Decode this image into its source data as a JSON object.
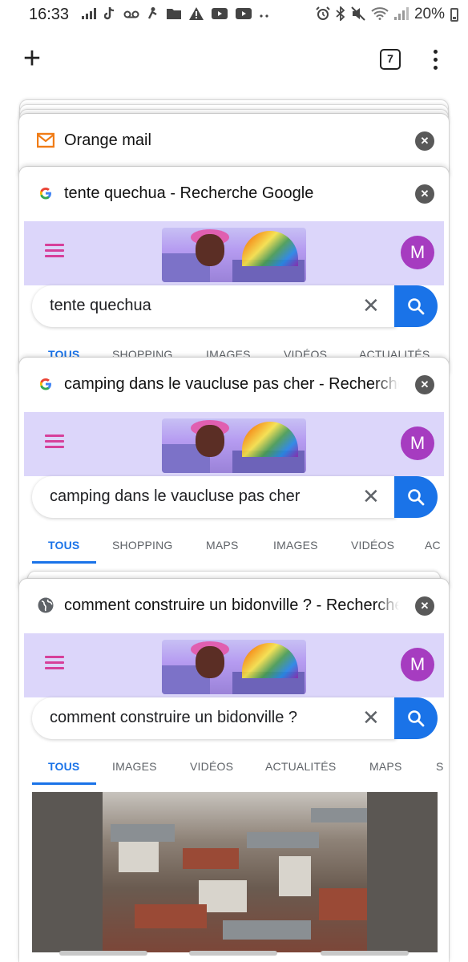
{
  "status_bar": {
    "time": "16:33",
    "battery": "20%",
    "left_icons": [
      "data-usage-icon",
      "tiktok-icon",
      "voicemail-icon",
      "accessibility-icon",
      "folder-icon",
      "warning-icon",
      "youtube-icon",
      "youtube-icon",
      "more-dots-icon"
    ],
    "right_icons": [
      "alarm-icon",
      "bluetooth-icon",
      "mute-icon",
      "wifi-icon",
      "signal-icon",
      "battery-icon"
    ]
  },
  "toolbar": {
    "new_tab_label": "+",
    "tab_count": "7"
  },
  "tabs": [
    {
      "title": "Orange mail",
      "favicon": "orange-mail-icon"
    },
    {
      "title": "tente quechua - Recherche Google",
      "favicon": "google-icon",
      "avatar": "M",
      "search_query": "tente quechua",
      "nav_tabs": [
        "TOUS",
        "SHOPPING",
        "IMAGES",
        "VIDÉOS",
        "ACTUALITÉS"
      ]
    },
    {
      "title": "camping dans le vaucluse pas cher - Recherche Google",
      "favicon": "google-icon",
      "avatar": "M",
      "search_query": "camping dans le vaucluse pas cher",
      "nav_tabs": [
        "TOUS",
        "SHOPPING",
        "MAPS",
        "IMAGES",
        "VIDÉOS",
        "AC"
      ]
    },
    {
      "title": "comment construire un bidonville ? - Recherche Google",
      "favicon": "globe-icon",
      "avatar": "M",
      "search_query": "comment construire un bidonville ?",
      "nav_tabs": [
        "TOUS",
        "IMAGES",
        "VIDÉOS",
        "ACTUALITÉS",
        "MAPS",
        "S"
      ]
    }
  ],
  "colors": {
    "google_header_bg": "#dcd6fa",
    "accent_blue": "#1a73e8",
    "avatar_purple": "#a63cc0",
    "hamburger_pink": "#d6409a",
    "orange_mail": "#f07c16"
  }
}
